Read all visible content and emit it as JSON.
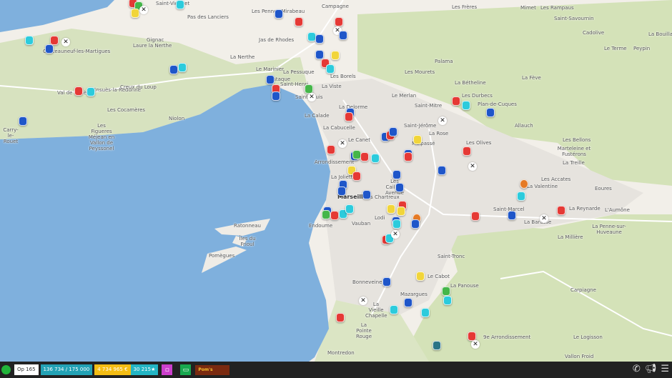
{
  "map": {
    "labels": [
      "Saint-Victoret",
      "Pas des Lanciers",
      "Les Pennes-Mirabeau",
      "Gignac",
      "Laure la Nerthe",
      "Châteauneuf-les-Martigues",
      "Jas de Rhodes",
      "La Nerthe",
      "Le Marinier",
      "La Pessuque",
      "L'Estaque",
      "Saint-Henri",
      "La Viste",
      "Les Borels",
      "Saint-Louis",
      "Val de Rivière",
      "Ensuès-la-Redonne",
      "Creux du Loup",
      "Les Cocamères",
      "Niolon",
      "Les Figueres Méjean en Vallon de Peyssonel",
      "Carry-le-Rouet",
      "La Calade",
      "La Cabucelle",
      "Les Frères",
      "Mimet",
      "Les Rampaus",
      "Saint-Savournin",
      "Cadolive",
      "La Bouilladisse",
      "Le Terme",
      "Peypin",
      "Palama",
      "Les Mourets",
      "La Bétheline",
      "La Fève",
      "Le Merlan",
      "Les Durbecs",
      "Saint-Mitre",
      "Plan-de-Cuques",
      "La Delorme",
      "Saint-Jérôme",
      "La Rose",
      "Allauch",
      "Le Canet",
      "Malpassé",
      "Les Olives",
      "Les Bellons",
      "Marteleine et Fustérons",
      "La Treille",
      "Les Accates",
      "Eoures",
      "La Valentine",
      "Arrondissement",
      "La Joliette",
      "Les Chartreux",
      "Marseille",
      "Les Caillols Avenue",
      "Saint-Marcel",
      "La Reynarde",
      "La Barasse",
      "L'Aumône",
      "La Penne-sur-Huveaune",
      "La Millière",
      "Endoume",
      "Vauban",
      "Lodi",
      "Ratonneau",
      "Îles du Frioul",
      "Pomègues",
      "Saint-Tronc",
      "Le Cabot",
      "La Panouse",
      "Bonneveine",
      "Mazargues",
      "La Vieille Chapelle",
      "La Pointe Rouge",
      "Carpiagne",
      "9e Arrondissement",
      "Le Logisson",
      "Montredon",
      "Vallon Froid",
      "Campagne"
    ],
    "marker_colors": {
      "fire": "#e53935",
      "police": "#1f56c9",
      "ambulance": "#2ccbdc",
      "yellow": "#f1d53a",
      "green": "#45b649",
      "orange": "#e57a25",
      "teal": "#2b7486"
    },
    "sea_color": "#7fb0dd",
    "land_color": "#f2efe9",
    "green_color": "#d4e2b8"
  },
  "bar": {
    "op": "Op 165",
    "credits": "136 734 / 175 000",
    "money": "4 734 965 €",
    "stars": "30 215",
    "star_icon": "★",
    "logo_text": "Pom's Opérateur",
    "colors": {
      "credits": "#23a2b5",
      "money": "#f4bd14",
      "stars": "#23b5c4",
      "purple": "#cc3fcc",
      "green": "#18a84f",
      "status": "#21b43a"
    }
  }
}
